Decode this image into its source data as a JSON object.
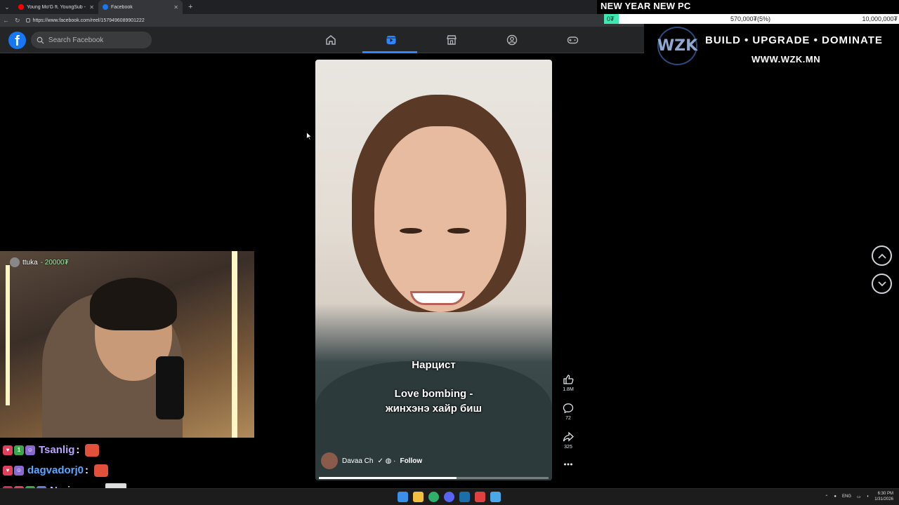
{
  "browser": {
    "tabs": [
      {
        "title": "Young Mo'G ft. YoungSub - Tugal",
        "color": "#ff0000"
      },
      {
        "title": "Facebook",
        "color": "#1877f2"
      }
    ],
    "url": "https://www.facebook.com/reel/1579496089901222"
  },
  "facebook": {
    "logo": "f",
    "search_placeholder": "Search Facebook",
    "nav": [
      "home-icon",
      "reels-icon",
      "marketplace-icon",
      "groups-icon",
      "gaming-icon"
    ],
    "active_nav": "reels-icon",
    "accent": "#1877f2"
  },
  "overlay": {
    "title": "NEW YEAR NEW PC",
    "goal_start": "0₮",
    "goal_current": "570,000₮(5%)",
    "goal_target": "10,000,000₮",
    "goal_fraction": 0.05,
    "brand": "WZK",
    "slogan": "BUILD • UPGRADE • DOMINATE",
    "site": "WWW.WZK.MN"
  },
  "reel": {
    "caption_top": "Нарцист",
    "caption_line1": "Love bombing -",
    "caption_line2": "жинхэнэ хайр биш",
    "author": "Davaa Ch",
    "follow": "Follow",
    "progress": 0.6,
    "likes": "1.8M",
    "comments": "72",
    "shares": "325"
  },
  "webcam": {
    "donor": "ttuka",
    "amount": "- 20000₮"
  },
  "chat": [
    {
      "name": "Tsanlig",
      "color": "#b9a4ff"
    },
    {
      "name": "dagvadorj0",
      "color": "#5aa8ff"
    },
    {
      "name": "Nari_sun",
      "color": "#c7b8ff"
    }
  ],
  "taskbar": {
    "lang": "ENG",
    "time": "6:30 PM",
    "date": "1/31/2026"
  }
}
